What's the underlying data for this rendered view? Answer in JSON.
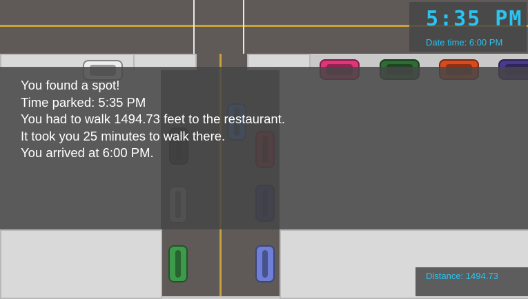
{
  "hud": {
    "clock": "5:35 PM",
    "date_time": "Date time: 6:00 PM",
    "distance": "Distance: 1494.73"
  },
  "result_message": {
    "line1": "You found a spot!",
    "line2": "Time parked: 5:35 PM",
    "line3": "You had to walk 1494.73 feet to the restaurant.",
    "line4": "It took you 25 minutes to walk there.",
    "line5": "You arrived at 6:00 PM."
  },
  "colors": {
    "hud_text": "#29c4f2",
    "message_text": "#ffffff",
    "road": "#5f5a58",
    "lane_line": "#c9a23a"
  }
}
